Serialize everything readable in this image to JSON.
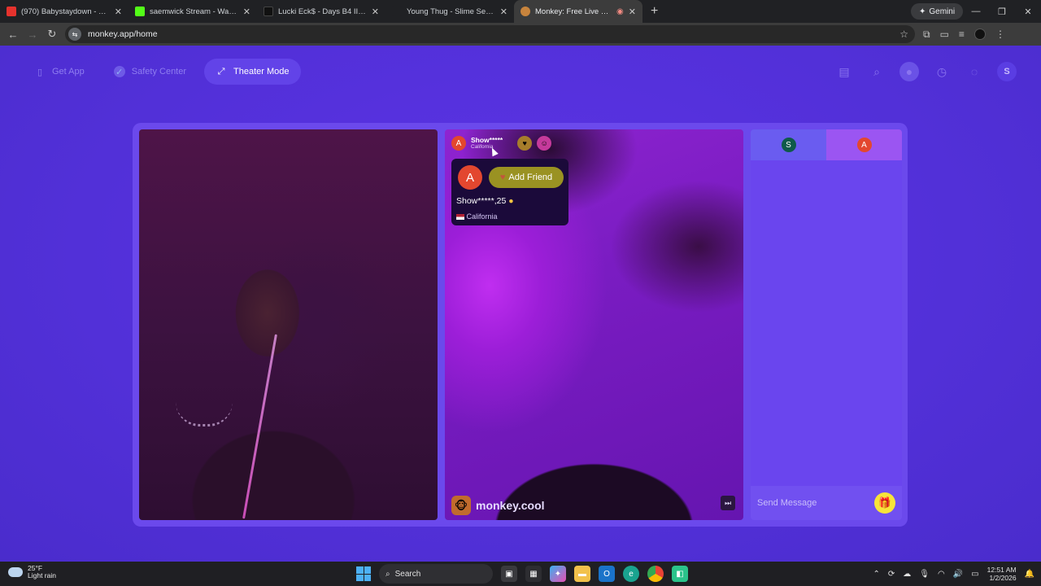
{
  "browser": {
    "tabs": [
      {
        "title": "(970) Babystaydown - G Lock (",
        "icon_color": "#e5322d"
      },
      {
        "title": "saemwick Stream - Watch Live",
        "icon_color": "#53fc18"
      },
      {
        "title": "Lucki Eck$ - Days B4 III on Emp",
        "icon_color": "#111111"
      },
      {
        "title": "Young Thug - Slime Season - L",
        "icon_color": "#202124"
      },
      {
        "title": "Monkey: Free Live Video Ch",
        "icon_color": "#c8843d"
      }
    ],
    "gemini_label": "Gemini",
    "url": "monkey.app/home"
  },
  "page": {
    "nav": {
      "get_app": "Get App",
      "safety_center": "Safety Center",
      "theater_mode": "Theater Mode"
    },
    "partner": {
      "initial": "A",
      "name_masked": "Show*****",
      "location_small": "California",
      "add_friend_label": "Add Friend",
      "name_age": "Show*****,25",
      "location": "California"
    },
    "user_initial": "S",
    "brand": "monkey.cool",
    "chat": {
      "tab_s": "S",
      "tab_a": "A",
      "placeholder": "Send Message"
    }
  },
  "taskbar": {
    "temperature": "25°F",
    "weather": "Light rain",
    "search": "Search",
    "time": "12:51 AM",
    "date": "1/2/2026"
  }
}
